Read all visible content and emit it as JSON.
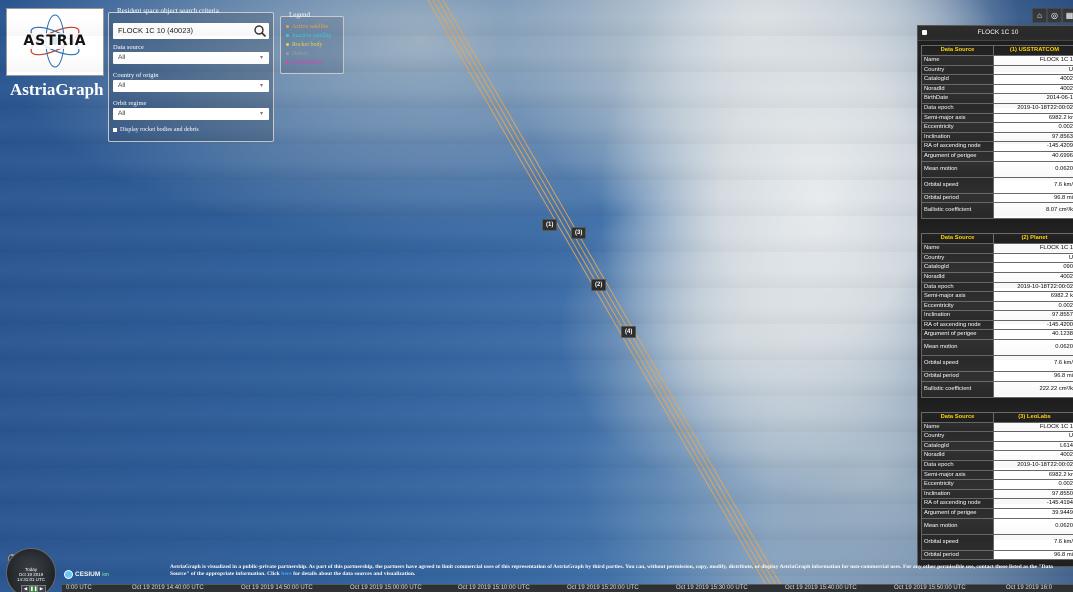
{
  "app": {
    "title": "AstriaGraph",
    "logo_text": "ASTRIA"
  },
  "search": {
    "legend": "Resident space object search criteria",
    "value": "FLOCK 1C 10 (40023)",
    "data_source_label": "Data source",
    "data_source_value": "All",
    "country_label": "Country of origin",
    "country_value": "All",
    "orbit_label": "Orbit regime",
    "orbit_value": "All",
    "checkbox_label": "Display rocket bodies and debris"
  },
  "legend": {
    "title": "Legend",
    "items": [
      {
        "label": "Active satellite",
        "color": "#e8a54a"
      },
      {
        "label": "Inactive satellite",
        "color": "#36d2e0"
      },
      {
        "label": "Rocket body",
        "color": "#e0d44a"
      },
      {
        "label": "Debris",
        "color": "#9a9a9a"
      },
      {
        "label": "Unclassified",
        "color": "#e040b0"
      }
    ]
  },
  "orbit_labels": [
    "(1)",
    "(3)",
    "(2)",
    "(4)"
  ],
  "info_panel": {
    "title": "FLOCK 1C 10",
    "sources": [
      {
        "header_key": "Data Source",
        "header_value": "(1) USSTRATCOM",
        "rows": [
          {
            "key": "Name",
            "value": "FLOCK 1C 1"
          },
          {
            "key": "Country",
            "value": "U"
          },
          {
            "key": "CatalogId",
            "value": "4002"
          },
          {
            "key": "NoradId",
            "value": "4002"
          },
          {
            "key": "BirthDate",
            "value": "2014-06-1"
          },
          {
            "key": "Data epoch",
            "value": "2019-10-18T22:00:02"
          },
          {
            "key": "Semi-major axis",
            "value": "6982.2 kr"
          },
          {
            "key": "Eccentricity",
            "value": "0.002"
          },
          {
            "key": "Inclination",
            "value": "97.8563"
          },
          {
            "key": "RA of ascending node",
            "value": "-145.4209"
          },
          {
            "key": "Argument of perigee",
            "value": "40.6996"
          },
          {
            "key": "Mean motion",
            "value": "0.0620"
          },
          {
            "key": "Orbital speed",
            "value": "7.6 km/"
          },
          {
            "key": "Orbital period",
            "value": "96.8 mi"
          },
          {
            "key": "Ballistic coefficient",
            "value": "8.07 cm²/k"
          }
        ]
      },
      {
        "header_key": "Data Source",
        "header_value": "(2) Planet",
        "rows": [
          {
            "key": "Name",
            "value": "FLOCK 1C 1"
          },
          {
            "key": "Country",
            "value": "U"
          },
          {
            "key": "CatalogId",
            "value": "090"
          },
          {
            "key": "NoradId",
            "value": "4002"
          },
          {
            "key": "Data epoch",
            "value": "2019-10-18T22:00:02"
          },
          {
            "key": "Semi-major axis",
            "value": "6982.2 k"
          },
          {
            "key": "Eccentricity",
            "value": "0.002"
          },
          {
            "key": "Inclination",
            "value": "97.8557"
          },
          {
            "key": "RA of ascending node",
            "value": "-145.4200"
          },
          {
            "key": "Argument of perigee",
            "value": "40.1238"
          },
          {
            "key": "Mean motion",
            "value": "0.0620"
          },
          {
            "key": "Orbital speed",
            "value": "7.6 km/"
          },
          {
            "key": "Orbital period",
            "value": "96.8 mi"
          },
          {
            "key": "Ballistic coefficient",
            "value": "222.22 cm²/k"
          }
        ]
      },
      {
        "header_key": "Data Source",
        "header_value": "(3) LeoLabs",
        "rows": [
          {
            "key": "Name",
            "value": "FLOCK 1C 1"
          },
          {
            "key": "Country",
            "value": "U"
          },
          {
            "key": "CatalogId",
            "value": "L614"
          },
          {
            "key": "NoradId",
            "value": "4002"
          },
          {
            "key": "Data epoch",
            "value": "2019-10-18T22:00:02"
          },
          {
            "key": "Semi-major axis",
            "value": "6982.2 kr"
          },
          {
            "key": "Eccentricity",
            "value": "0.002"
          },
          {
            "key": "Inclination",
            "value": "97.8550"
          },
          {
            "key": "RA of ascending node",
            "value": "-145.4194"
          },
          {
            "key": "Argument of perigee",
            "value": "39.9449"
          },
          {
            "key": "Mean motion",
            "value": "0.0620"
          },
          {
            "key": "Orbital speed",
            "value": "7.6 km/"
          },
          {
            "key": "Orbital period",
            "value": "96.8 mi"
          }
        ]
      }
    ]
  },
  "credit": {
    "text_before": "AstriaGraph is visualized in a public-private partnership. As part of this partnership, the partners have agreed to limit commercial uses of this representation of AstriaGraph by third parties. You can, without permission, copy, modify, distribute, or display AstriaGraph information for non-commercial uses. For any other permissible use, contact those listed as the \"Data Source\" of the appropriate information. Click",
    "link": "here",
    "text_after": "for details about the data sources and visualization."
  },
  "timeline": {
    "ticks": [
      "0:00 UTC",
      "Oct 19 2019 14:40:00 UTC",
      "Oct 19 2019 14:50:00 UTC",
      "Oct 19 2019 15:00:00 UTC",
      "Oct 19 2019 15:10:00 UTC",
      "Oct 19 2019 15:20:00 UTC",
      "Oct 19 2019 15:30:00 UTC",
      "Oct 19 2019 15:40:00 UTC",
      "Oct 19 2019 15:50:00 UTC",
      "Oct 19 2019 16:0"
    ]
  },
  "clock": {
    "line1": "Today",
    "line2": "Oct 19 2019",
    "line3": "14:31:01 UTC"
  },
  "cesium": {
    "name": "CESIUM",
    "suffix": "ion"
  }
}
